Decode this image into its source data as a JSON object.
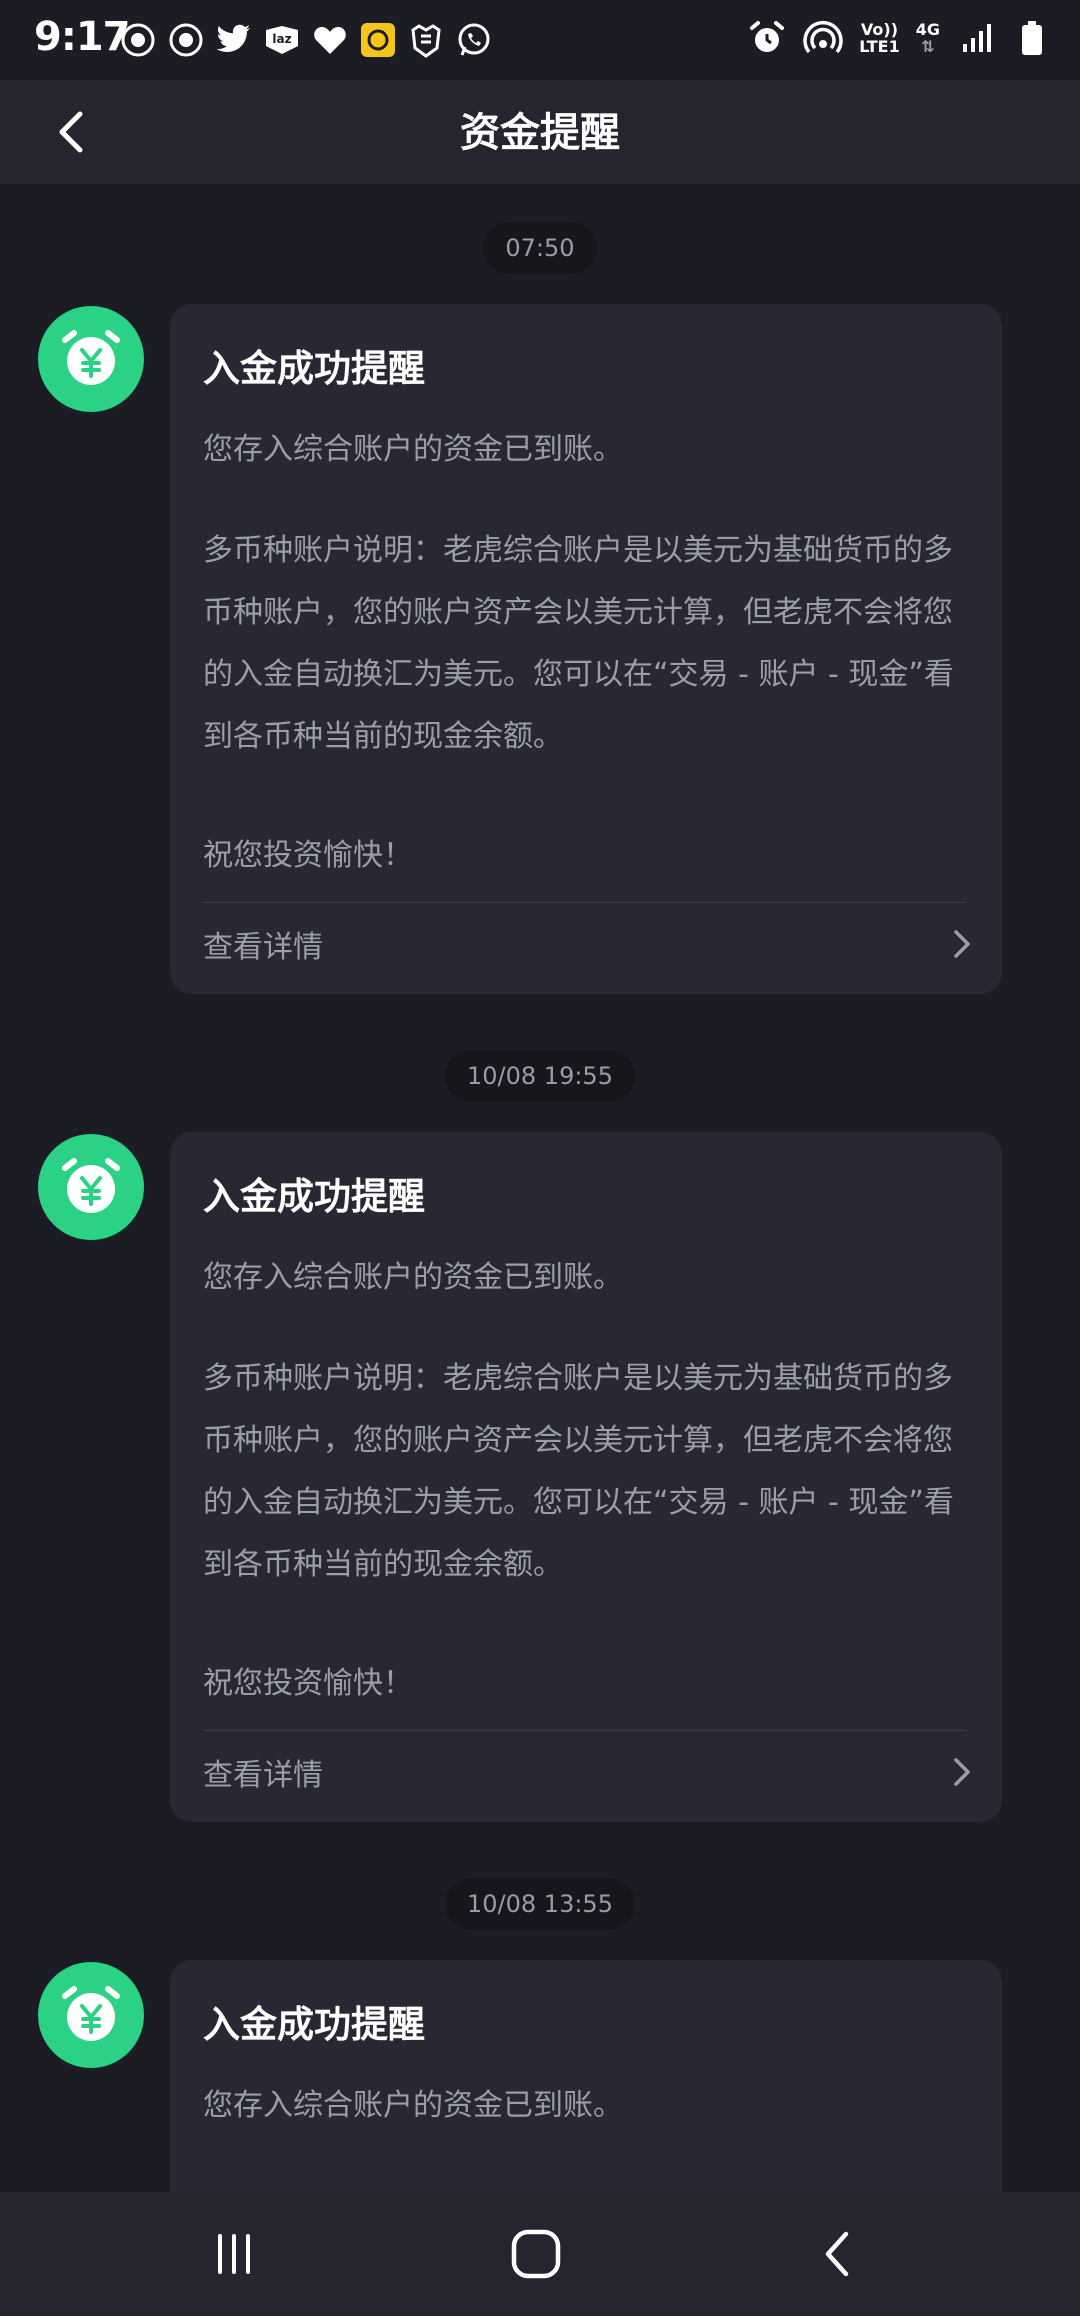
{
  "status_bar": {
    "time": "9:17",
    "network_top": "Vo))",
    "network_bottom": "LTE1",
    "network_type": "4G",
    "left_icons": [
      "notification-icon",
      "notification-icon",
      "twitter-icon",
      "lazada-icon",
      "heart-icon",
      "app-icon",
      "app-icon",
      "whatsapp-icon"
    ]
  },
  "header": {
    "title": "资金提醒"
  },
  "messages": [
    {
      "timestamp": "07:50",
      "title": "入金成功提醒",
      "line1": "您存入综合账户的资金已到账。",
      "paragraph": "多币种账户说明：老虎综合账户是以美元为基础货币的多币种账户，您的账户资产会以美元计算，但老虎不会将您的入金自动换汇为美元。您可以在“交易 - 账户 - 现金”看到各币种当前的现金余额。",
      "closing": "祝您投资愉快！",
      "details_label": "查看详情"
    },
    {
      "timestamp": "10/08 19:55",
      "title": "入金成功提醒",
      "line1": "您存入综合账户的资金已到账。",
      "paragraph": "多币种账户说明：老虎综合账户是以美元为基础货币的多币种账户，您的账户资产会以美元计算，但老虎不会将您的入金自动换汇为美元。您可以在“交易 - 账户 - 现金”看到各币种当前的现金余额。",
      "closing": "祝您投资愉快！",
      "details_label": "查看详情"
    },
    {
      "timestamp": "10/08 13:55",
      "title": "入金成功提醒",
      "line1": "您存入综合账户的资金已到账。"
    }
  ],
  "colors": {
    "accent": "#2bd184",
    "background": "#1c1d24",
    "card": "#272834",
    "muted_text": "#9c9daa"
  }
}
